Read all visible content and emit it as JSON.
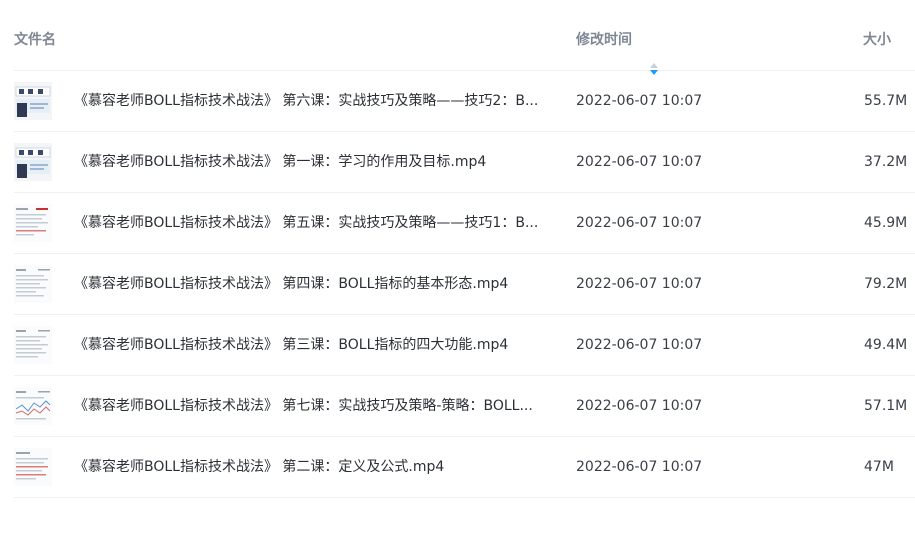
{
  "table": {
    "headers": {
      "name": "文件名",
      "modified": "修改时间",
      "size": "大小"
    },
    "sort": {
      "column": "modified",
      "icon": "sort-icon",
      "accent_color": "#1e9bff"
    },
    "rows": [
      {
        "thumb": "video-thumbnail",
        "name": "《慕容老师BOLL指标技术战法》 第六课：实战技巧及策略——技巧2：B...",
        "modified": "2022-06-07 10:07",
        "size": "55.7M"
      },
      {
        "thumb": "video-thumbnail",
        "name": "《慕容老师BOLL指标技术战法》 第一课：学习的作用及目标.mp4",
        "modified": "2022-06-07 10:07",
        "size": "37.2M"
      },
      {
        "thumb": "video-thumbnail",
        "name": "《慕容老师BOLL指标技术战法》 第五课：实战技巧及策略——技巧1：B...",
        "modified": "2022-06-07 10:07",
        "size": "45.9M"
      },
      {
        "thumb": "video-thumbnail",
        "name": "《慕容老师BOLL指标技术战法》 第四课：BOLL指标的基本形态.mp4",
        "modified": "2022-06-07 10:07",
        "size": "79.2M"
      },
      {
        "thumb": "video-thumbnail",
        "name": "《慕容老师BOLL指标技术战法》 第三课：BOLL指标的四大功能.mp4",
        "modified": "2022-06-07 10:07",
        "size": "49.4M"
      },
      {
        "thumb": "video-thumbnail",
        "name": "《慕容老师BOLL指标技术战法》 第七课：实战技巧及策略-策略：BOLL...",
        "modified": "2022-06-07 10:07",
        "size": "57.1M"
      },
      {
        "thumb": "video-thumbnail",
        "name": "《慕容老师BOLL指标技术战法》 第二课：定义及公式.mp4",
        "modified": "2022-06-07 10:07",
        "size": "47M"
      }
    ]
  }
}
